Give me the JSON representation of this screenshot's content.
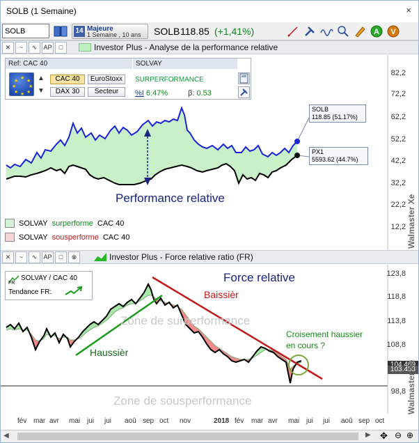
{
  "window": {
    "title": "SOLB (1 Semaine)",
    "close": "×"
  },
  "toolbar": {
    "symbol_value": "SOLB",
    "period_line1": "Majeure",
    "period_line2": "1 Semaine , 10 ans",
    "quote_symbol": "SOLB",
    "quote_price": "118.85",
    "quote_change": "(+1,41%)",
    "icons": [
      "draw-line-icon",
      "tools-icon",
      "wave-icon",
      "magnifier-icon",
      "marker-icon",
      "alert-a-icon",
      "alert-v-icon"
    ]
  },
  "top_panel": {
    "title": "Investor Plus - Analyse de la performance relative",
    "ref_header": "Ref: CAC 40",
    "solvay_header": "SOLVAY",
    "buttons": {
      "cac40": "CAC 40",
      "eurostoxx": "EuroStoxx",
      "dax30": "DAX 30",
      "secteur": "Secteur"
    },
    "status": "SURPERFORMANCE",
    "pct_label": "%I",
    "pct_value": "6.47%",
    "beta_label": "β:",
    "beta_value": "0.53",
    "annotation": "Performance relative",
    "label_solb_1": "SOLB",
    "label_solb_2": "118.85 (51.17%)",
    "label_px1_1": "PX1",
    "label_px1_2": "5593.62 (44.7%)",
    "legend": [
      {
        "name": "SOLVAY",
        "state": "surperforme",
        "ref": "CAC 40",
        "color": "#d6f2d6"
      },
      {
        "name": "SOLVAY",
        "state": "sousperforme",
        "ref": "CAC 40",
        "color": "#f4d6d6"
      }
    ],
    "yaxis": [
      "82,2",
      "72,2",
      "62,2",
      "52,2",
      "42,2",
      "32,2",
      "22,2",
      "12,2"
    ]
  },
  "bottom_panel": {
    "title": "Investor Plus - Force relative ratio  (FR)",
    "fr_label": "SOLVAY / CAC 40",
    "tendance_label": "Tendance FR:",
    "annotation_force": "Force relative",
    "annotation_baissier": "Baissièr",
    "annotation_haussier": "Haussièr",
    "annotation_croisement_1": "Croisement haussier",
    "annotation_croisement_2": "en cours ?",
    "zone_top": "Zone de surperformance",
    "zone_bottom": "Zone de sousperformance",
    "yaxis": [
      "123,8",
      "118,8",
      "113,8",
      "108,8",
      "98,8"
    ],
    "badge_1": "104.469",
    "badge_2": "103.453"
  },
  "watermark": "Walmaster Xe",
  "time_axis": [
    "fév",
    "mar",
    "avr",
    "mai",
    "jui",
    "jui",
    "aoû",
    "sep",
    "oct",
    "nov",
    "2018",
    "fév",
    "mar",
    "avr",
    "mai",
    "jui",
    "jui",
    "aoû",
    "sep",
    "oct"
  ],
  "colors": {
    "blue_line": "#1a23d8",
    "black_line": "#000000",
    "green_fill": "#c9f0c9",
    "red_fill": "#f28c8c",
    "trend_up": "#1a9a1a",
    "trend_down": "#c01818"
  }
}
